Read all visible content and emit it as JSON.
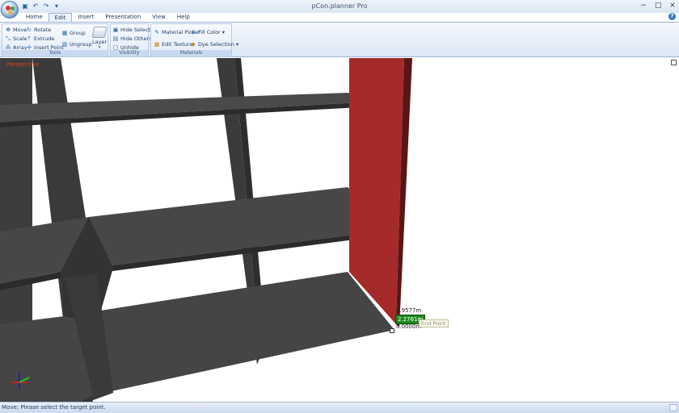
{
  "window": {
    "title": "pCon.planner Pro",
    "minimize_glyph": "−",
    "maximize_glyph": "□",
    "close_glyph": "×"
  },
  "quick_access": {
    "save_glyph": "▣",
    "undo_glyph": "↶",
    "redo_glyph": "↷",
    "customize_glyph": "▾"
  },
  "tabs": [
    "Home",
    "Edit",
    "Insert",
    "Presentation",
    "View",
    "Help"
  ],
  "active_tab": "Edit",
  "ribbon": {
    "tools": {
      "label": "Tools",
      "move": "Move",
      "rotate": "Rotate",
      "scale": "Scale",
      "extrude": "Extrude",
      "array": "Array",
      "insert_point": "Insert Point",
      "group": "Group",
      "ungroup": "Ungroup",
      "layer": "Layer"
    },
    "visibility": {
      "label": "Visibility",
      "hide_selection": "Hide Selection",
      "hide_others": "Hide Others",
      "unhide": "Unhide"
    },
    "materials": {
      "label": "Materials",
      "material_picker": "Material Picker",
      "fill_color": "Fill Color",
      "edit_texture": "Edit Texture",
      "dye_selection": "Dye Selection"
    }
  },
  "viewport": {
    "view_name": "Perspective",
    "measure_1": "0.9577m",
    "measure_2": "2.2761m",
    "measure_3": "0.0000m",
    "snap_tooltip": "End Point"
  },
  "colors": {
    "shelf": "#3d3d3d",
    "shelf_top": "#4a4a4a",
    "selected_panel": "#a52a2a",
    "accent": "#1d8a1d"
  },
  "status": {
    "text": "Move: Please select the target point."
  }
}
